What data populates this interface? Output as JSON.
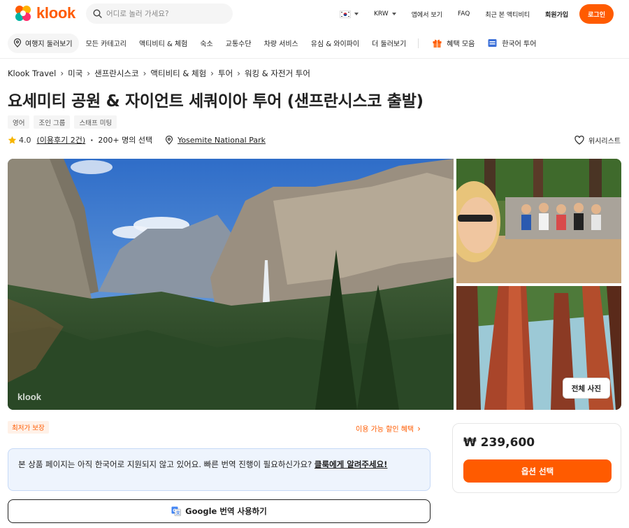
{
  "header": {
    "brand": "klook",
    "search_placeholder": "어디로 놀러 가세요?",
    "currency": "KRW",
    "app_link": "앱에서 보기",
    "faq": "FAQ",
    "recent": "최근 본 액티비티",
    "signup": "회원가입",
    "login": "로그인"
  },
  "nav": {
    "items": [
      "여행지 둘러보기",
      "모든 카테고리",
      "액티비티 & 체험",
      "숙소",
      "교통수단",
      "차량 서비스",
      "유심 & 와이파이",
      "더 둘러보기"
    ],
    "benefits": "혜택 모음",
    "korean_tour": "한국어 투어"
  },
  "breadcrumb": [
    "Klook Travel",
    "미국",
    "샌프란시스코",
    "액티비티 & 체험",
    "투어",
    "워킹 & 자전거 투어"
  ],
  "product": {
    "title": "요세미티 공원 & 자이언트 세쿼이아 투어 (샌프란시스코 출발)",
    "tags": [
      "영어",
      "조인 그룹",
      "스태프 미팅"
    ],
    "rating": "4.0",
    "reviews": "(이용후기 2건)",
    "booked": "200+ 명의 선택",
    "location": "Yosemite National Park",
    "wishlist": "위시리스트",
    "all_photos": "전체 사진",
    "watermark": "klook"
  },
  "promo": {
    "lowest_price": "최저가 보장",
    "discounts": "이용 가능 할인 혜택"
  },
  "notice": {
    "text": "본 상품 페이지는 아직 한국어로 지원되지 않고 있어요. 빠른 번역 진행이 필요하신가요? ",
    "link": "클룩에게 알려주세요!"
  },
  "translate_button": "Google 번역 사용하기",
  "price_card": {
    "price": "₩ 239,600",
    "select": "옵션 선택"
  },
  "colors": {
    "brand": "#ff5b00",
    "notice_bg": "#eef4fd"
  }
}
